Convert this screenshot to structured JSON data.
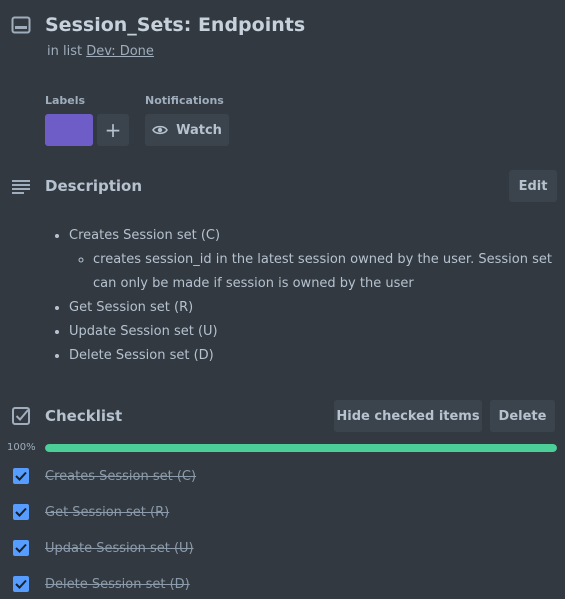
{
  "card": {
    "title": "Session_Sets: Endpoints",
    "list_prefix": "in list",
    "list_name": "Dev: Done"
  },
  "labels": {
    "heading": "Labels",
    "add_icon": "plus-icon",
    "color": "#6e5dc6"
  },
  "notifications": {
    "heading": "Notifications",
    "watch_label": "Watch",
    "icon": "eye-icon"
  },
  "description": {
    "heading": "Description",
    "edit_label": "Edit",
    "items": [
      "Creates Session set (C)",
      "creates session_id in the latest session owned by the user. Session set can only be made if session is owned by the user",
      "Get Session set (R)",
      "Update Session set (U)",
      "Delete Session set (D)"
    ]
  },
  "checklist": {
    "heading": "Checklist",
    "hide_label": "Hide checked items",
    "delete_label": "Delete",
    "progress_text": "100%",
    "progress": 1.0,
    "progress_color": "#4bce97",
    "items": [
      {
        "label": "Creates Session set (C)",
        "checked": true
      },
      {
        "label": "Get Session set (R)",
        "checked": true
      },
      {
        "label": "Update Session set (U)",
        "checked": true
      },
      {
        "label": "Delete Session set (D)",
        "checked": true
      }
    ]
  },
  "colors": {
    "background": "#323940",
    "checkbox": "#579dff"
  }
}
